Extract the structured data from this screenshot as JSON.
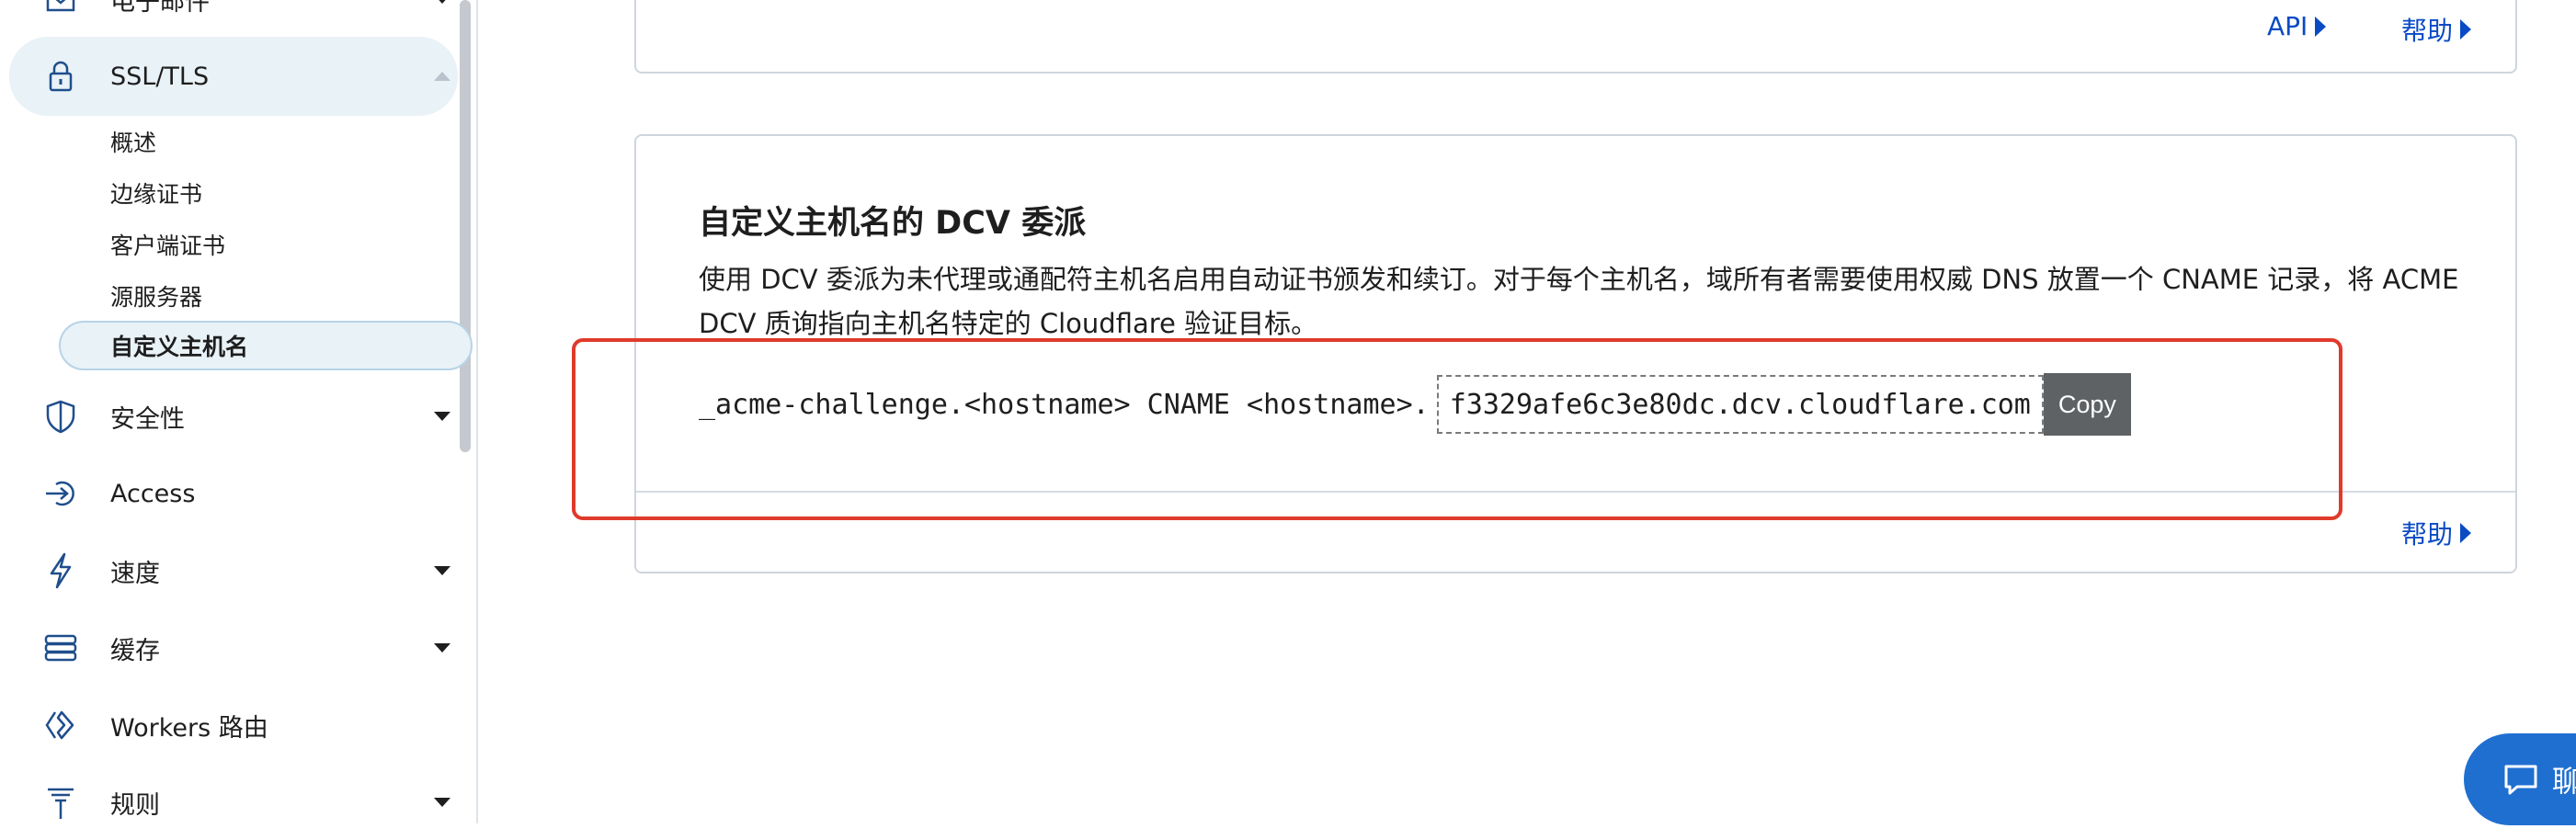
{
  "sidebar": {
    "items": [
      {
        "label": "电子邮件",
        "icon": "email-icon",
        "expandable": true
      },
      {
        "label": "SSL/TLS",
        "icon": "lock-icon",
        "expandable": true,
        "expanded": true
      },
      {
        "label": "安全性",
        "icon": "shield-icon",
        "expandable": true
      },
      {
        "label": "Access",
        "icon": "access-icon",
        "expandable": false
      },
      {
        "label": "速度",
        "icon": "lightning-icon",
        "expandable": true
      },
      {
        "label": "缓存",
        "icon": "cache-icon",
        "expandable": true
      },
      {
        "label": "Workers 路由",
        "icon": "workers-icon",
        "expandable": false
      },
      {
        "label": "规则",
        "icon": "rules-icon",
        "expandable": true
      }
    ],
    "ssl_subitems": [
      "概述",
      "边缘证书",
      "客户端证书",
      "源服务器",
      "自定义主机名"
    ],
    "active_subitem": "自定义主机名"
  },
  "top_card": {
    "api_link": "API",
    "help_link": "帮助"
  },
  "dcv_card": {
    "title": "自定义主机名的 DCV 委派",
    "description": "使用 DCV 委派为未代理或通配符主机名启用自动证书颁发和续订。对于每个主机名，域所有者需要使用权威 DNS 放置一个 CNAME 记录，将 ACME DCV 质询指向主机名特定的 Cloudflare 验证目标。",
    "record_prefix": "_acme-challenge.<hostname> CNAME <hostname>.",
    "record_target": "f3329afe6c3e80dc.dcv.cloudflare.com",
    "copy_label": "Copy",
    "help_link": "帮助"
  },
  "chat": {
    "label": "聊"
  },
  "colors": {
    "link": "#0a4bc4",
    "highlight": "#e03a2b",
    "active_bg": "#e8f2f7",
    "chat": "#1f6fd1"
  }
}
